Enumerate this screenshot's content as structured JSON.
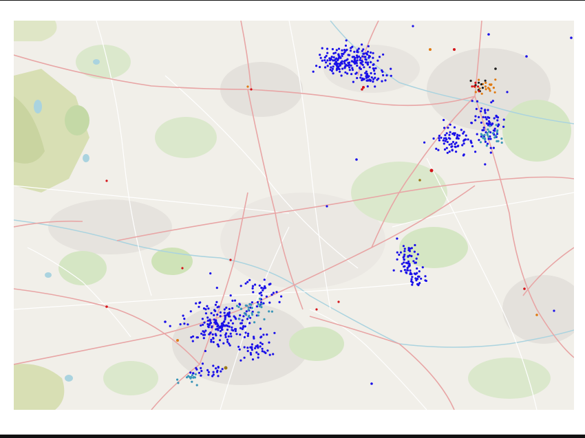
{
  "map": {
    "basemap": "street-map",
    "colors": {
      "background": "#f1efe9",
      "urban": "#e4e1dc",
      "green": "#d5e6c4",
      "park": "#cfe3b8",
      "wood": "#c4d9a6",
      "water": "#aad3df",
      "major_road": "#e8a5a5",
      "minor_road": "#ffffff",
      "frame_rule": "#111111"
    },
    "point_categories": [
      {
        "name": "blue",
        "color": "#1a10e8"
      },
      {
        "name": "teal",
        "color": "#3a96b8"
      },
      {
        "name": "orange",
        "color": "#e07a12"
      },
      {
        "name": "red",
        "color": "#d4141a"
      },
      {
        "name": "olive",
        "color": "#9a7a1a"
      },
      {
        "name": "black",
        "color": "#1c1c1c"
      }
    ],
    "place_labels": []
  }
}
